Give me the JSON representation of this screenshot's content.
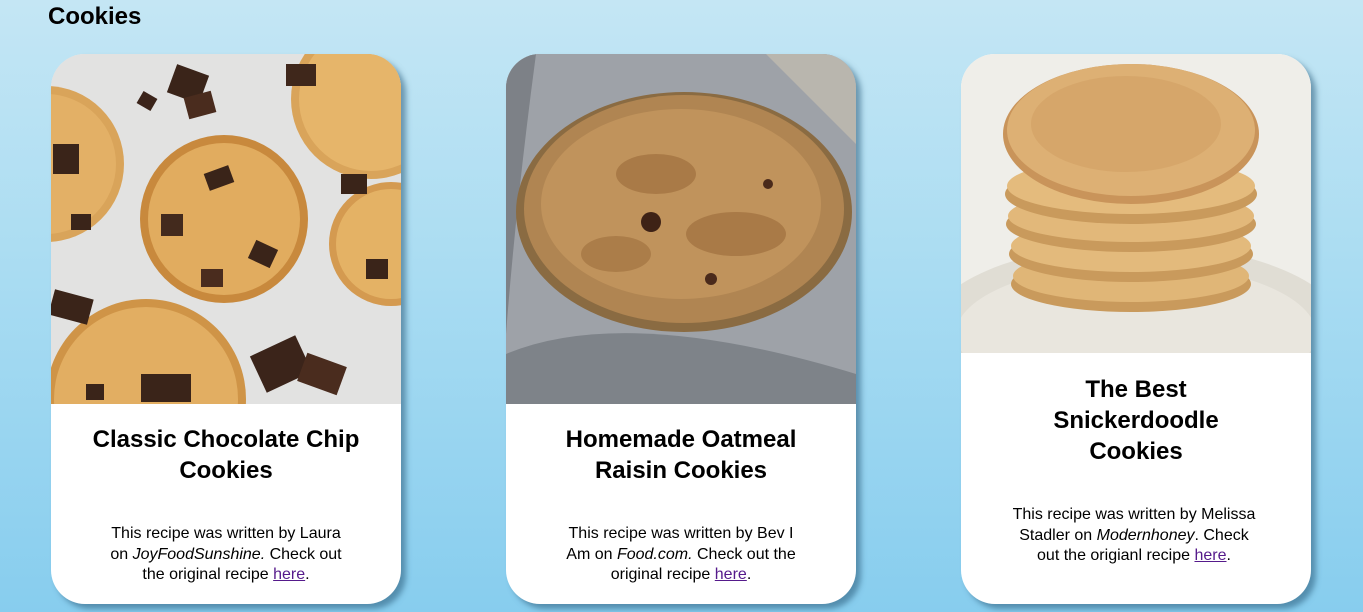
{
  "page": {
    "title": "Cookies"
  },
  "cards": [
    {
      "image_subject": "chocolate chip cookies",
      "title": "Classic Chocolate Chip Cookies",
      "credit_prefix": "This recipe was written by Laura on ",
      "source": "JoyFoodSunshine.",
      "credit_mid": " Check out the original recipe ",
      "link_text": "here",
      "credit_suffix": "."
    },
    {
      "image_subject": "oatmeal raisin cookie",
      "title": "Homemade Oatmeal Raisin Cookies",
      "credit_prefix": "This recipe was written by Bev I Am on ",
      "source": "Food.com.",
      "credit_mid": " Check out the original recipe ",
      "link_text": "here",
      "credit_suffix": "."
    },
    {
      "image_subject": "snickerdoodle cookie stack",
      "title": "The Best Snickerdoodle Cookies",
      "credit_prefix": "This recipe was written by Melissa Stadler on ",
      "source": "Modernhoney",
      "credit_mid": ". Check out the origianl recipe ",
      "link_text": "here",
      "credit_suffix": "."
    }
  ],
  "colors": {
    "background_top": "#c4e6f4",
    "background_bottom": "#87cdee",
    "card": "#ffffff",
    "link": "#551a8b"
  }
}
